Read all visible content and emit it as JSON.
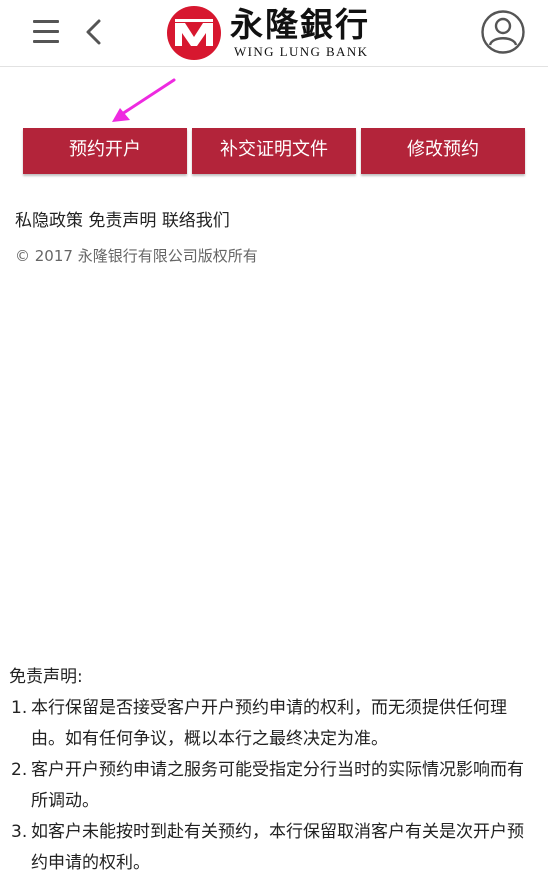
{
  "header": {
    "menu_icon": "hamburger-menu-icon",
    "back_icon": "chevron-left-icon",
    "logo": {
      "chinese_name": "永隆銀行",
      "english_name": "WING LUNG BANK",
      "brand_color": "#d7172f"
    },
    "user_icon": "user-profile-icon"
  },
  "buttons": [
    {
      "label": "预约开户"
    },
    {
      "label": "补交证明文件"
    },
    {
      "label": "修改预约"
    }
  ],
  "button_color": "#b3243a",
  "annotation_arrow_color": "#ee2ae0",
  "footer": {
    "links": [
      "私隐政策",
      "免责声明",
      "联络我们"
    ],
    "copyright": "© 2017 永隆银行有限公司版权所有"
  },
  "disclaimer": {
    "title": "免责声明:",
    "items": [
      {
        "num": "1.",
        "text": "本行保留是否接受客户开户预约申请的权利，而无须提供任何理由。如有任何争议，概以本行之最终决定为准。"
      },
      {
        "num": "2.",
        "text": "客户开户预约申请之服务可能受指定分行当时的实际情况影响而有所调动。"
      },
      {
        "num": "3.",
        "text": "如客户未能按时到赴有关预约，本行保留取消客户有关是次开户预约申请的权利。"
      }
    ]
  }
}
